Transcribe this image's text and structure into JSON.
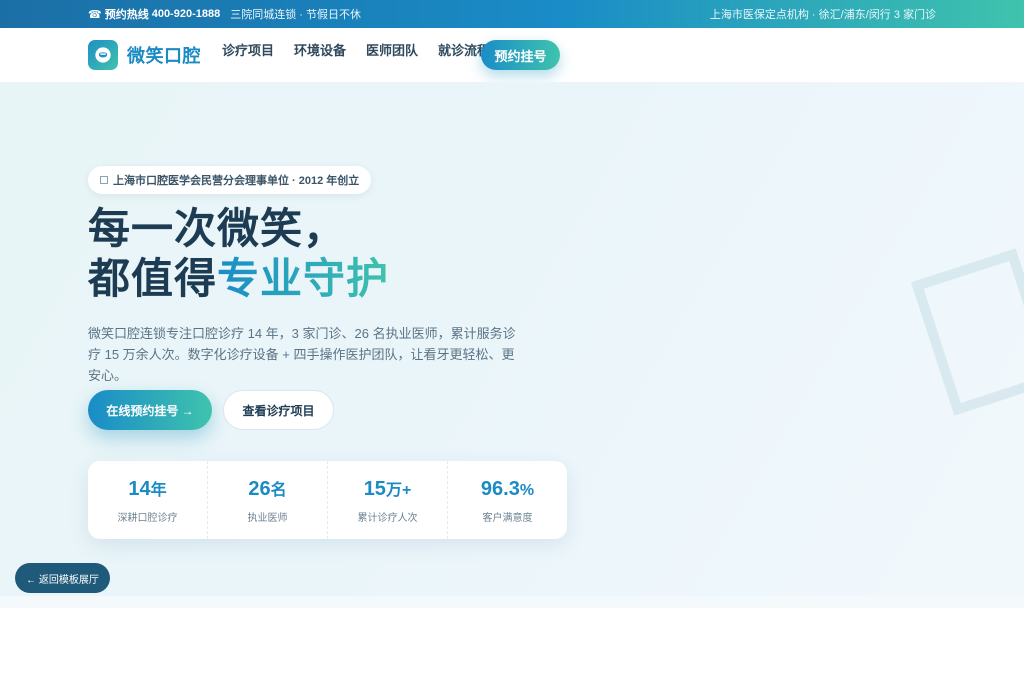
{
  "topbar": {
    "hotline_icon": "phone-icon",
    "hotline_label": "预约热线",
    "hotline_number": "400-920-1888",
    "note": "三院同城连锁 · 节假日不休",
    "right_text": "上海市医保定点机构 · 徐汇/浦东/闵行 3 家门诊"
  },
  "nav": {
    "brand": "微笑口腔",
    "logo_icon": "smile-tooth-icon",
    "items": [
      {
        "label": "诊疗项目"
      },
      {
        "label": "环境设备"
      },
      {
        "label": "医师团队"
      },
      {
        "label": "就诊流程"
      }
    ],
    "cta": "预约挂号"
  },
  "hero": {
    "badge": "上海市口腔医学会民营分会理事单位 · 2012 年创立",
    "title_line1": "每一次微笑，",
    "title_line2_plain": "都值得",
    "title_line2_highlight": "专业守护",
    "lead": "微笑口腔连锁专注口腔诊疗 14 年，3 家门诊、26 名执业医师，累计服务诊疗 15 万余人次。数字化诊疗设备 + 四手操作医护团队，让看牙更轻松、更安心。",
    "primary_button": "在线预约挂号 →",
    "secondary_button": "查看诊疗项目"
  },
  "stats": [
    {
      "value": "14",
      "unit": "年",
      "label": "深耕口腔诊疗"
    },
    {
      "value": "26",
      "unit": "名",
      "label": "执业医师"
    },
    {
      "value": "15",
      "unit": "万+",
      "label": "累计诊疗人次"
    },
    {
      "value": "96.3",
      "unit": "%",
      "label": "客户满意度"
    }
  ],
  "back_button": "← 返回模板展厅",
  "colors": {
    "brand_blue": "#1b8bc4",
    "brand_teal": "#3fc3ad",
    "text_dark": "#1d3b52",
    "back_button_bg": "#1f5a7a"
  }
}
